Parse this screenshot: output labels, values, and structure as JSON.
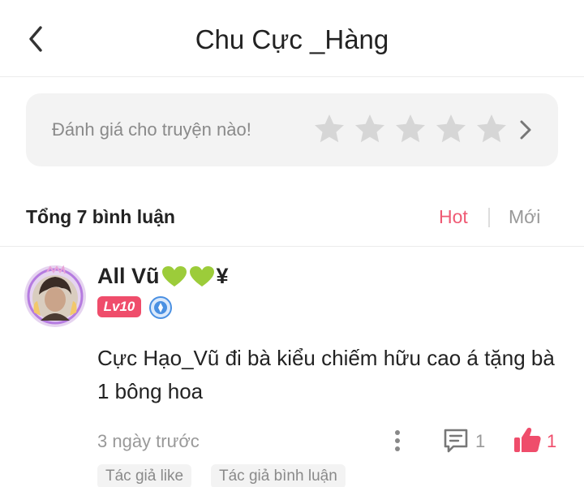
{
  "header": {
    "title": "Chu Cực _Hàng",
    "back_icon": "chevron-left-icon"
  },
  "rating": {
    "prompt": "Đánh giá cho truyện nào!",
    "stars_total": 5,
    "stars_selected": 0,
    "star_icon": "star-icon",
    "chevron_icon": "chevron-right-icon",
    "star_color": "#d6d6d6"
  },
  "comments": {
    "count_label": "Tổng 7 bình luận",
    "sort_hot": "Hot",
    "sort_new": "Mới",
    "active_sort_color": "#ef5a74",
    "items": [
      {
        "username": "All Vũ",
        "username_suffix": "¥",
        "username_icons": [
          "green-heart-icon",
          "green-heart-icon"
        ],
        "level": "Lv10",
        "badge_icon": "verified-pen-icon",
        "text": "Cực Hạo_Vũ đi bà kiểu chiếm hữu cao á tặng bà 1 bông hoa",
        "time": "3 ngày trước",
        "reply_count": "1",
        "like_count": "1",
        "tags": [
          "Tác giả like",
          "Tác giả bình luận"
        ]
      }
    ]
  },
  "colors": {
    "accent": "#ef4d6b",
    "heart_green": "#9ccc3a",
    "muted_text": "#999999"
  }
}
